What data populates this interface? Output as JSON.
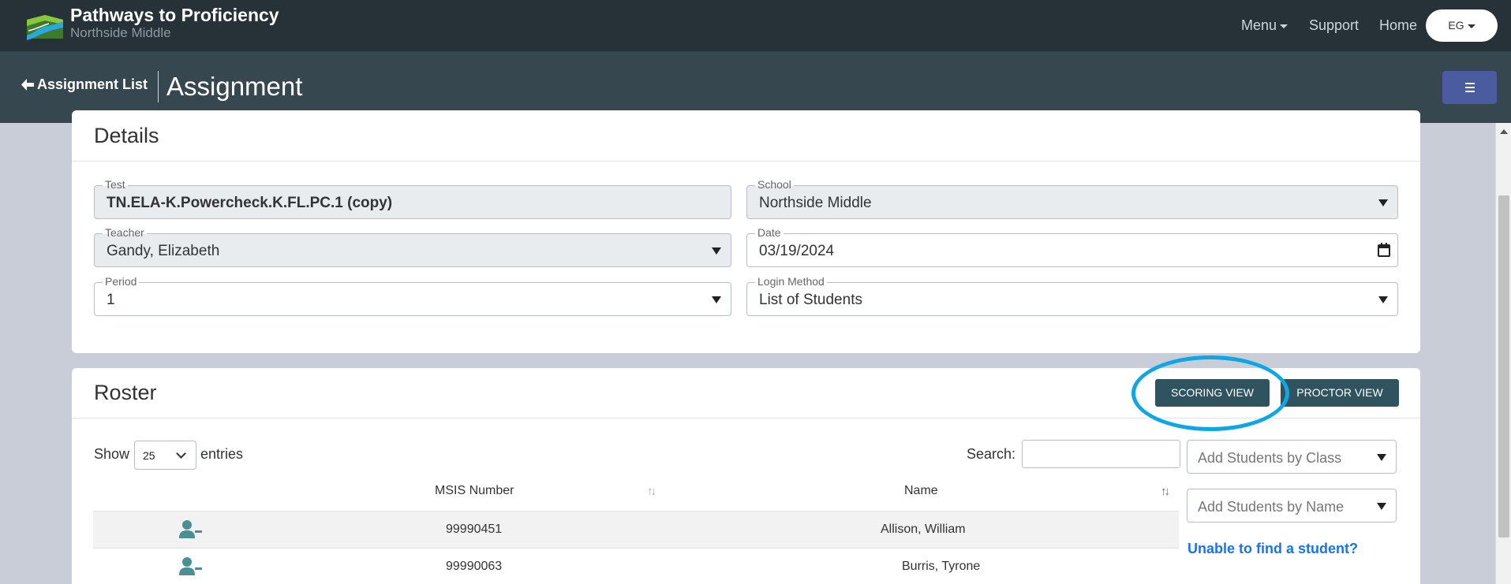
{
  "app": {
    "title": "Pathways to Proficiency",
    "subtitle": "Northside Middle"
  },
  "nav": {
    "menu_label": "Menu",
    "support_label": "Support",
    "home_label": "Home",
    "user_initials": "EG"
  },
  "page": {
    "back_label": "Assignment List",
    "title": "Assignment"
  },
  "details": {
    "heading": "Details",
    "test": {
      "label": "Test",
      "value": "TN.ELA-K.Powercheck.K.FL.PC.1 (copy)"
    },
    "school": {
      "label": "School",
      "value": "Northside Middle"
    },
    "teacher": {
      "label": "Teacher",
      "value": "Gandy, Elizabeth"
    },
    "date": {
      "label": "Date",
      "value": "03/19/2024"
    },
    "period": {
      "label": "Period",
      "value": "1"
    },
    "login_method": {
      "label": "Login Method",
      "value": "List of Students"
    }
  },
  "roster": {
    "heading": "Roster",
    "scoring_view_label": "SCORING VIEW",
    "proctor_view_label": "PROCTOR VIEW",
    "show_label": "Show",
    "entries_value": "25",
    "entries_label": "entries",
    "search_label": "Search:",
    "search_value": "",
    "add_by_class_placeholder": "Add Students by Class",
    "add_by_name_placeholder": "Add Students by Name",
    "unable_link": "Unable to find a student?",
    "columns": [
      "MSIS Number",
      "Name"
    ],
    "rows": [
      {
        "msis": "99990451",
        "name": "Allison, William"
      },
      {
        "msis": "99990063",
        "name": "Burris, Tyrone"
      }
    ]
  },
  "colors": {
    "topbar": "#263238",
    "subbar": "#37474f",
    "accent_button": "#2f5460",
    "highlight": "#0ea6e3",
    "link": "#1a73e8"
  }
}
